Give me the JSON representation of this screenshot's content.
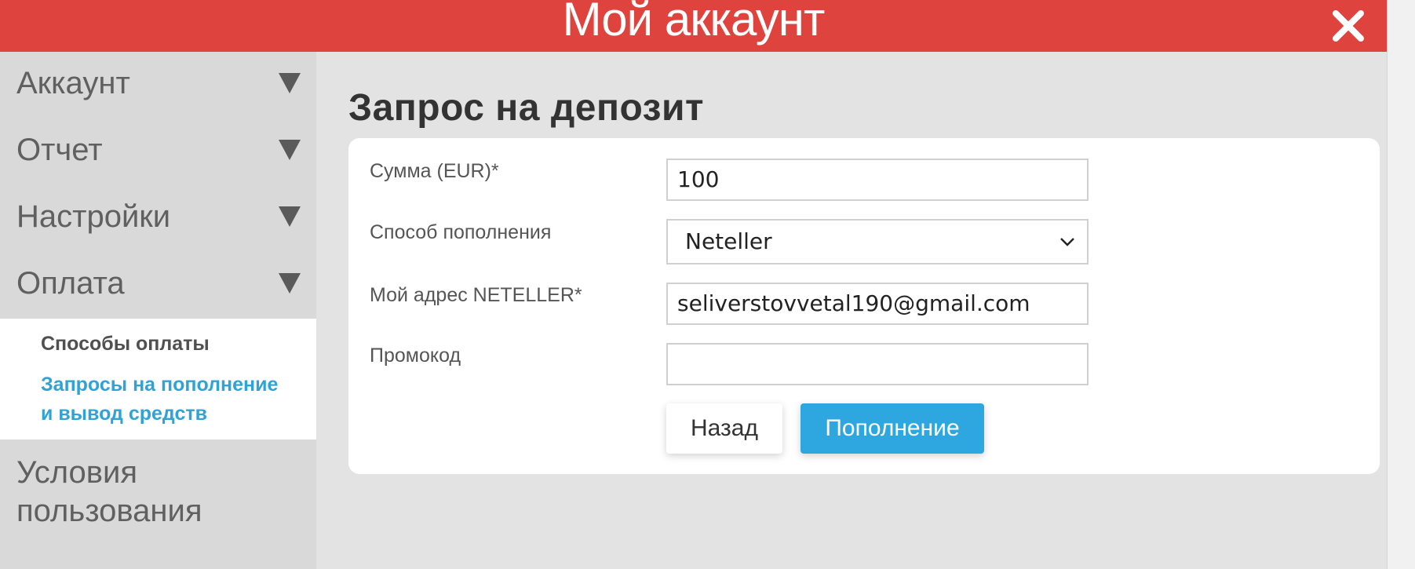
{
  "header": {
    "title": "Мой аккаунт",
    "close_icon": "close-icon"
  },
  "sidebar": {
    "items": [
      {
        "label": "Аккаунт",
        "icon": "triangle-down-icon"
      },
      {
        "label": "Отчет",
        "icon": "triangle-down-icon"
      },
      {
        "label": "Настройки",
        "icon": "triangle-down-icon"
      },
      {
        "label": "Оплата",
        "icon": "triangle-down-icon"
      }
    ],
    "submenu": [
      {
        "label": "Способы оплаты"
      },
      {
        "label": "Запросы на пополнение и вывод средств"
      }
    ],
    "terms_line1": "Условия",
    "terms_line2": "пользования"
  },
  "main": {
    "title": "Запрос на депозит",
    "form": {
      "amount_label": "Сумма (EUR)*",
      "amount_value": "100",
      "method_label": "Способ пополнения",
      "method_value": "Neteller",
      "address_label": "Мой адрес NETELLER*",
      "address_value": "seliverstovvetal190@gmail.com",
      "promo_label": "Промокод",
      "promo_value": ""
    },
    "buttons": {
      "back": "Назад",
      "deposit": "Пополнение"
    }
  },
  "colors": {
    "header": "#de433d",
    "accent": "#2ea7e0",
    "link_active": "#2fa3d6"
  }
}
